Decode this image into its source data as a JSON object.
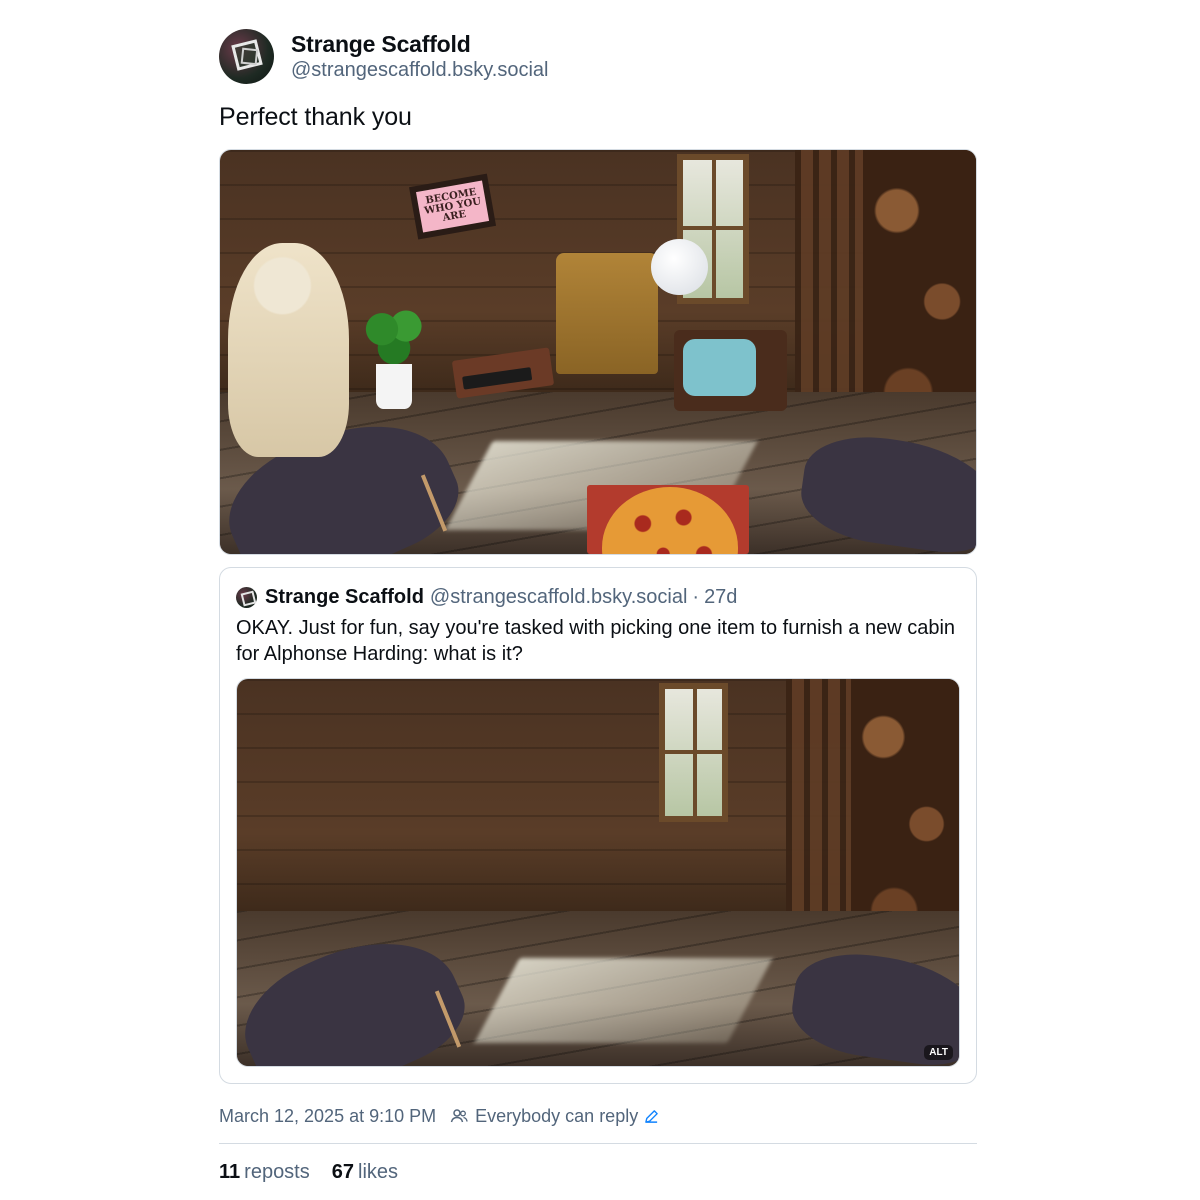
{
  "author": {
    "display_name": "Strange Scaffold",
    "handle": "@strangescaffold.bsky.social"
  },
  "post": {
    "text": "Perfect thank you",
    "main_image_sign_text": "BECOME WHO YOU ARE"
  },
  "quote": {
    "display_name": "Strange Scaffold",
    "handle": "@strangescaffold.bsky.social",
    "separator": "·",
    "age": "27d",
    "text": "OKAY. Just for fun, say you're tasked with picking one item to furnish a new cabin for Alphonse Harding: what is it?",
    "alt_badge": "ALT"
  },
  "meta": {
    "timestamp": "March 12, 2025 at 9:10 PM",
    "reply_setting": "Everybody can reply"
  },
  "stats": {
    "reposts_count": "11",
    "reposts_label": "reposts",
    "likes_count": "67",
    "likes_label": "likes"
  },
  "colors": {
    "text": "#0b0f14",
    "muted": "#52657b",
    "border": "#d4dbe2",
    "link": "#1083fe"
  },
  "icons": [
    "avatar",
    "people-icon",
    "pencil-icon"
  ]
}
